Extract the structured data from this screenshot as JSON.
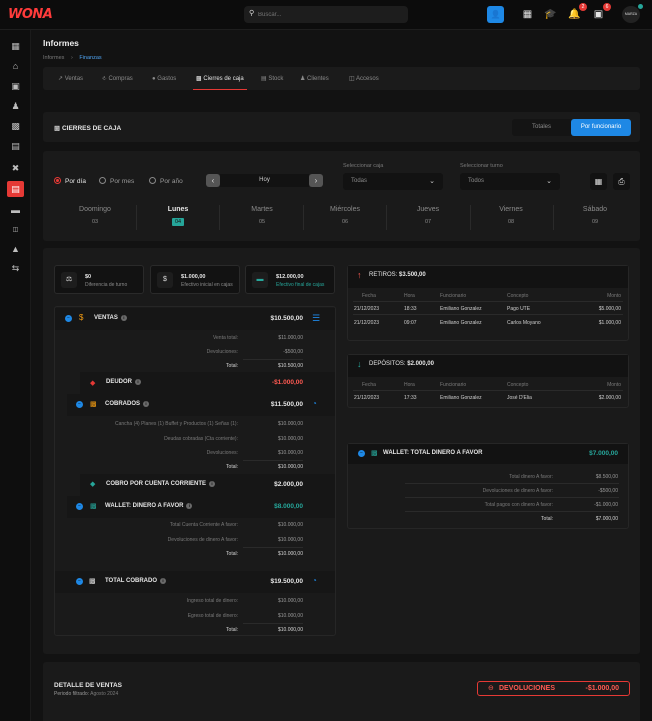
{
  "brand": {
    "logo_text": "WONA",
    "accent": "#e53935",
    "active_tab_color": "#1e88e5",
    "success": "#26a69a"
  },
  "topbar": {
    "search_placeholder": "Buscar...",
    "icons": [
      "add-user-icon",
      "calendar-icon",
      "graduation-icon",
      "bell-icon",
      "id-card-icon",
      "avatar"
    ],
    "bell_badge": "2",
    "card_badge": "6",
    "avatar_text": "MARZA"
  },
  "sidebar": {
    "items": [
      "dashboard-icon",
      "home-icon",
      "calendar-icon",
      "users-icon",
      "register-icon",
      "briefcase-icon",
      "tools-icon",
      "reports-icon",
      "card-icon",
      "gate-icon",
      "graduation-icon",
      "transfer-icon"
    ],
    "active_index": 7
  },
  "page": {
    "title": "Informes",
    "breadcrumb": [
      "Informes",
      "Finanzas"
    ]
  },
  "tabs": [
    "Ventas",
    "Compras",
    "Gastos",
    "Cierres de caja",
    "Stock",
    "Clientes",
    "Accesos"
  ],
  "active_tab": "Cierres de caja",
  "section": {
    "title": "CIERRES DE CAJA",
    "toggle": [
      "Totales",
      "Por funcionario"
    ],
    "toggle_active": "Por funcionario"
  },
  "filters": {
    "period_options": [
      "Por día",
      "Por mes",
      "Por año"
    ],
    "period_selected": "Por día",
    "date_value": "Hoy",
    "caja_label": "Seleccionar caja",
    "caja_value": "Todas",
    "turno_label": "Seleccionar turno",
    "turno_value": "Todos"
  },
  "days": [
    {
      "name": "Doomingo",
      "num": "03"
    },
    {
      "name": "Lunes",
      "num": "04"
    },
    {
      "name": "Martes",
      "num": "05"
    },
    {
      "name": "Miércoles",
      "num": "06"
    },
    {
      "name": "Jueves",
      "num": "07"
    },
    {
      "name": "Viernes",
      "num": "08"
    },
    {
      "name": "Sábado",
      "num": "09"
    }
  ],
  "active_day": "Lunes",
  "stats": [
    {
      "value": "$0",
      "label": "Diferencia de turno",
      "icon": "balance-icon"
    },
    {
      "value": "$1.000,00",
      "label": "Efectivo inicial en cajas",
      "icon": "dollar-icon"
    },
    {
      "value": "$12.000,00",
      "label": "Efectivo final de cajas",
      "icon": "cash-icon"
    }
  ],
  "ventas": {
    "title": "VENTAS",
    "amount": "$10.500,00",
    "rows": [
      {
        "label": "Venta total:",
        "value": "$11.000,00"
      },
      {
        "label": "Devoluciones:",
        "value": "-$500,00"
      },
      {
        "label": "Total:",
        "value": "$10.500,00"
      }
    ]
  },
  "deudor": {
    "title": "DEUDOR",
    "amount": "-$1.000,00"
  },
  "cobrados": {
    "title": "COBRADOS",
    "amount": "$11.500,00",
    "rows": [
      {
        "label": "Cancha (4) Planes (1) Buffet y Productos (1) Señas (1):",
        "value": "$10.000,00"
      },
      {
        "label": "Deudas cobradas (Cta corriente):",
        "value": "$10.000,00"
      },
      {
        "label": "Devoluciones:",
        "value": "$10.000,00"
      },
      {
        "label": "Total:",
        "value": "$10.000,00"
      }
    ]
  },
  "cobro_cc": {
    "title": "COBRO POR CUENTA CORRIENTE",
    "amount": "$2.000,00"
  },
  "wallet_favor": {
    "title": "WALLET: DINERO A FAVOR",
    "amount": "$8.000,00",
    "rows": [
      {
        "label": "Total Cuenta Corriente A favor:",
        "value": "$10.000,00"
      },
      {
        "label": "Devoluciones de dinero A favor:",
        "value": "$10.000,00"
      },
      {
        "label": "Total:",
        "value": "$10.000,00"
      }
    ]
  },
  "total_cobrado": {
    "title": "TOTAL COBRADO",
    "amount": "$19.500,00",
    "rows": [
      {
        "label": "Ingreso total de dinero:",
        "value": "$10.000,00"
      },
      {
        "label": "Egreso total de dinero:",
        "value": "$10.000,00"
      },
      {
        "label": "Total:",
        "value": "$10.000,00"
      }
    ]
  },
  "retiros": {
    "title": "RETIROS:",
    "amount": "$3.500,00",
    "headers": [
      "Fecha",
      "Hora",
      "Funcionario",
      "Concepto",
      "Monto"
    ],
    "rows": [
      [
        "21/12/2023",
        "18:33",
        "Emiliano Gonzalez",
        "Pago UTE",
        "$5.000,00"
      ],
      [
        "21/12/2023",
        "09:07",
        "Emiliano Gonzalez",
        "Carlos Moyano",
        "$1.000,00"
      ]
    ]
  },
  "depositos": {
    "title": "DEPÓSITOS:",
    "amount": "$2.000,00",
    "headers": [
      "Fecha",
      "Hora",
      "Funcionario",
      "Concepto",
      "Monto"
    ],
    "rows": [
      [
        "21/12/2023",
        "17:33",
        "Emiliano Gonzalez",
        "José D'Elia",
        "$2.000,00"
      ]
    ]
  },
  "wallet_total": {
    "title": "WALLET: TOTAL DINERO A FAVOR",
    "amount": "$7.000,00",
    "rows": [
      {
        "label": "Total dinero A favor:",
        "value": "$8.500,00"
      },
      {
        "label": "Devoluciones de dinero A favor:",
        "value": "-$500,00"
      },
      {
        "label": "Total pagos con dinero A favor:",
        "value": "-$1.000,00"
      },
      {
        "label": "Total:",
        "value": "$7.000,00"
      }
    ]
  },
  "detalle": {
    "title": "DETALLE DE VENTAS",
    "period_label": "Periodo filtrado:",
    "period_value": "Agosto 2024",
    "devoluciones_label": "DEVOLUCIONES",
    "devoluciones_amount": "-$1.000,00"
  }
}
